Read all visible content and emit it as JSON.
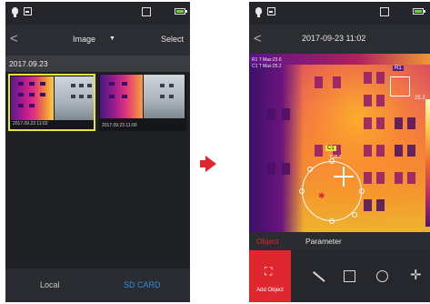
{
  "left_screen": {
    "nav": {
      "back": "<",
      "title": "Image",
      "dropdown_caret": "▼",
      "select": "Select"
    },
    "date_header": "2017.09.23",
    "thumbnails": [
      {
        "caption": "2017.09.23 11:02",
        "selected": true
      },
      {
        "caption": "2017.09.23 11:00",
        "selected": false
      }
    ],
    "tabs": {
      "local": "Local",
      "sd_card": "SD CARD"
    }
  },
  "right_screen": {
    "nav": {
      "back": "<",
      "title": "2017-09-23 11:02"
    },
    "overlay_lines": [
      "R1 T Max:23.6",
      "C1 T Max:25.2"
    ],
    "r1_label": "R1",
    "scale_value": "25.2",
    "c1_label": "C1",
    "c1_sub": "T:25.2",
    "object_tabs": {
      "object": "Object",
      "parameter": "Parameter"
    },
    "tools": {
      "add_object": "Add Object"
    }
  },
  "colors": {
    "accent": "#e0262e",
    "selected_border": "#e7e14a",
    "sd_tab": "#2f8fe0",
    "battery": "#6fd13a"
  }
}
